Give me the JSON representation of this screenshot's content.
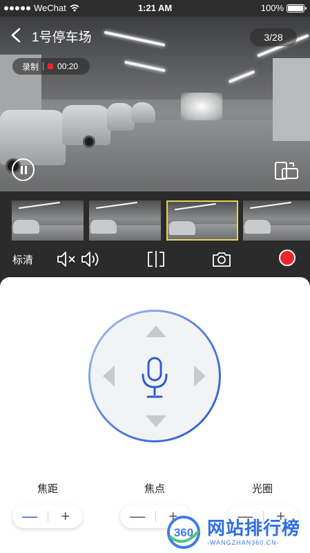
{
  "status_bar": {
    "carrier": "WeChat",
    "time": "1:21 AM",
    "battery": "100%",
    "battery_fraction": 1.0
  },
  "header": {
    "title": "1号停车场",
    "page_counter": "3/28"
  },
  "recording": {
    "label": "录制",
    "duration": "00:20"
  },
  "thumbnails": {
    "count": 4,
    "selected_index": 2
  },
  "toolbar": {
    "quality_label": "标清"
  },
  "controls": [
    {
      "label": "焦距",
      "minus": "—",
      "plus": "+"
    },
    {
      "label": "焦点",
      "minus": "—",
      "plus": "+"
    },
    {
      "label": "光圈",
      "minus": "—",
      "plus": "+"
    }
  ],
  "watermark": {
    "logo_number": "360",
    "text": "网站排行榜",
    "subtext": "-WANGZHAN360.CN-"
  },
  "colors": {
    "accent": "#2f5bcf",
    "record_red": "#e8262c",
    "selected_thumb": "#e8d44d"
  },
  "icons": [
    "back-chevron-icon",
    "pause-icon",
    "rotate-screen-icon",
    "mute-icon",
    "volume-icon",
    "split-screen-icon",
    "camera-icon",
    "record-icon",
    "microphone-icon",
    "arrow-up-icon",
    "arrow-down-icon",
    "arrow-left-icon",
    "arrow-right-icon"
  ]
}
